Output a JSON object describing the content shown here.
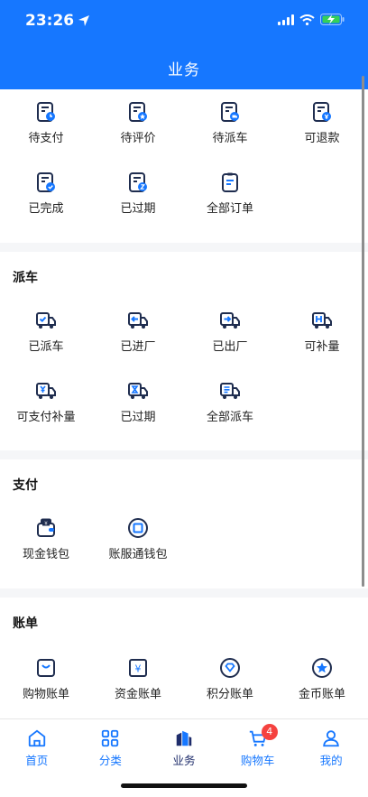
{
  "status_bar": {
    "time": "23:26"
  },
  "header": {
    "title": "业务"
  },
  "orders": {
    "items": [
      {
        "label": "待支付",
        "icon": "order-pending-payment-icon"
      },
      {
        "label": "待评价",
        "icon": "order-pending-review-icon"
      },
      {
        "label": "待派车",
        "icon": "order-pending-dispatch-icon"
      },
      {
        "label": "可退款",
        "icon": "order-refundable-icon"
      },
      {
        "label": "已完成",
        "icon": "order-completed-icon"
      },
      {
        "label": "已过期",
        "icon": "order-expired-icon"
      },
      {
        "label": "全部订单",
        "icon": "all-orders-icon"
      }
    ]
  },
  "dispatch": {
    "title": "派车",
    "items": [
      {
        "label": "已派车",
        "icon": "truck-dispatched-icon"
      },
      {
        "label": "已进厂",
        "icon": "truck-entered-icon"
      },
      {
        "label": "已出厂",
        "icon": "truck-exited-icon"
      },
      {
        "label": "可补量",
        "icon": "truck-supplement-icon"
      },
      {
        "label": "可支付补量",
        "icon": "truck-pay-supplement-icon"
      },
      {
        "label": "已过期",
        "icon": "truck-expired-icon"
      },
      {
        "label": "全部派车",
        "icon": "truck-all-icon"
      }
    ]
  },
  "payment": {
    "title": "支付",
    "items": [
      {
        "label": "现金钱包",
        "icon": "cash-wallet-icon"
      },
      {
        "label": "账服通钱包",
        "icon": "account-wallet-icon"
      }
    ]
  },
  "bills": {
    "title": "账单",
    "items": [
      {
        "label": "购物账单",
        "icon": "shopping-bill-icon"
      },
      {
        "label": "资金账单",
        "icon": "fund-bill-icon"
      },
      {
        "label": "积分账单",
        "icon": "points-bill-icon"
      },
      {
        "label": "金币账单",
        "icon": "coin-bill-icon"
      }
    ]
  },
  "tabbar": {
    "items": [
      {
        "label": "首页",
        "icon": "home-icon"
      },
      {
        "label": "分类",
        "icon": "category-icon"
      },
      {
        "label": "业务",
        "icon": "business-icon"
      },
      {
        "label": "购物车",
        "icon": "cart-icon"
      },
      {
        "label": "我的",
        "icon": "profile-icon"
      }
    ],
    "cart_badge": "4",
    "active": "业务"
  },
  "colors": {
    "primary": "#1677ff",
    "badge": "#f5423f",
    "icon_dark": "#1f2d4f"
  }
}
